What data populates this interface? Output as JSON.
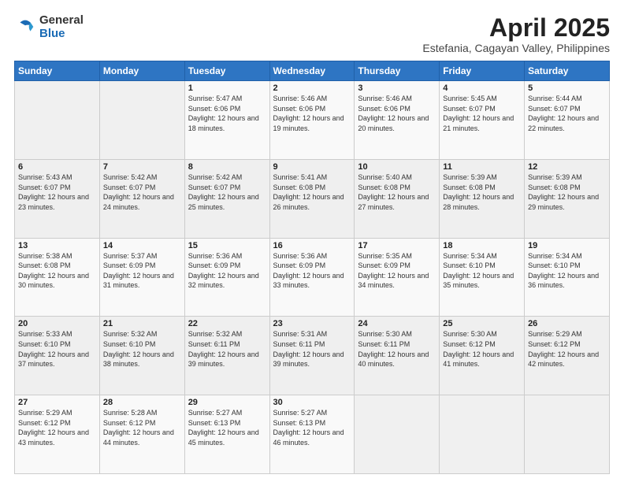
{
  "logo": {
    "general": "General",
    "blue": "Blue"
  },
  "title": {
    "month_year": "April 2025",
    "location": "Estefania, Cagayan Valley, Philippines"
  },
  "weekdays": [
    "Sunday",
    "Monday",
    "Tuesday",
    "Wednesday",
    "Thursday",
    "Friday",
    "Saturday"
  ],
  "weeks": [
    [
      {
        "day": "",
        "sunrise": "",
        "sunset": "",
        "daylight": ""
      },
      {
        "day": "",
        "sunrise": "",
        "sunset": "",
        "daylight": ""
      },
      {
        "day": "1",
        "sunrise": "Sunrise: 5:47 AM",
        "sunset": "Sunset: 6:06 PM",
        "daylight": "Daylight: 12 hours and 18 minutes."
      },
      {
        "day": "2",
        "sunrise": "Sunrise: 5:46 AM",
        "sunset": "Sunset: 6:06 PM",
        "daylight": "Daylight: 12 hours and 19 minutes."
      },
      {
        "day": "3",
        "sunrise": "Sunrise: 5:46 AM",
        "sunset": "Sunset: 6:06 PM",
        "daylight": "Daylight: 12 hours and 20 minutes."
      },
      {
        "day": "4",
        "sunrise": "Sunrise: 5:45 AM",
        "sunset": "Sunset: 6:07 PM",
        "daylight": "Daylight: 12 hours and 21 minutes."
      },
      {
        "day": "5",
        "sunrise": "Sunrise: 5:44 AM",
        "sunset": "Sunset: 6:07 PM",
        "daylight": "Daylight: 12 hours and 22 minutes."
      }
    ],
    [
      {
        "day": "6",
        "sunrise": "Sunrise: 5:43 AM",
        "sunset": "Sunset: 6:07 PM",
        "daylight": "Daylight: 12 hours and 23 minutes."
      },
      {
        "day": "7",
        "sunrise": "Sunrise: 5:42 AM",
        "sunset": "Sunset: 6:07 PM",
        "daylight": "Daylight: 12 hours and 24 minutes."
      },
      {
        "day": "8",
        "sunrise": "Sunrise: 5:42 AM",
        "sunset": "Sunset: 6:07 PM",
        "daylight": "Daylight: 12 hours and 25 minutes."
      },
      {
        "day": "9",
        "sunrise": "Sunrise: 5:41 AM",
        "sunset": "Sunset: 6:08 PM",
        "daylight": "Daylight: 12 hours and 26 minutes."
      },
      {
        "day": "10",
        "sunrise": "Sunrise: 5:40 AM",
        "sunset": "Sunset: 6:08 PM",
        "daylight": "Daylight: 12 hours and 27 minutes."
      },
      {
        "day": "11",
        "sunrise": "Sunrise: 5:39 AM",
        "sunset": "Sunset: 6:08 PM",
        "daylight": "Daylight: 12 hours and 28 minutes."
      },
      {
        "day": "12",
        "sunrise": "Sunrise: 5:39 AM",
        "sunset": "Sunset: 6:08 PM",
        "daylight": "Daylight: 12 hours and 29 minutes."
      }
    ],
    [
      {
        "day": "13",
        "sunrise": "Sunrise: 5:38 AM",
        "sunset": "Sunset: 6:08 PM",
        "daylight": "Daylight: 12 hours and 30 minutes."
      },
      {
        "day": "14",
        "sunrise": "Sunrise: 5:37 AM",
        "sunset": "Sunset: 6:09 PM",
        "daylight": "Daylight: 12 hours and 31 minutes."
      },
      {
        "day": "15",
        "sunrise": "Sunrise: 5:36 AM",
        "sunset": "Sunset: 6:09 PM",
        "daylight": "Daylight: 12 hours and 32 minutes."
      },
      {
        "day": "16",
        "sunrise": "Sunrise: 5:36 AM",
        "sunset": "Sunset: 6:09 PM",
        "daylight": "Daylight: 12 hours and 33 minutes."
      },
      {
        "day": "17",
        "sunrise": "Sunrise: 5:35 AM",
        "sunset": "Sunset: 6:09 PM",
        "daylight": "Daylight: 12 hours and 34 minutes."
      },
      {
        "day": "18",
        "sunrise": "Sunrise: 5:34 AM",
        "sunset": "Sunset: 6:10 PM",
        "daylight": "Daylight: 12 hours and 35 minutes."
      },
      {
        "day": "19",
        "sunrise": "Sunrise: 5:34 AM",
        "sunset": "Sunset: 6:10 PM",
        "daylight": "Daylight: 12 hours and 36 minutes."
      }
    ],
    [
      {
        "day": "20",
        "sunrise": "Sunrise: 5:33 AM",
        "sunset": "Sunset: 6:10 PM",
        "daylight": "Daylight: 12 hours and 37 minutes."
      },
      {
        "day": "21",
        "sunrise": "Sunrise: 5:32 AM",
        "sunset": "Sunset: 6:10 PM",
        "daylight": "Daylight: 12 hours and 38 minutes."
      },
      {
        "day": "22",
        "sunrise": "Sunrise: 5:32 AM",
        "sunset": "Sunset: 6:11 PM",
        "daylight": "Daylight: 12 hours and 39 minutes."
      },
      {
        "day": "23",
        "sunrise": "Sunrise: 5:31 AM",
        "sunset": "Sunset: 6:11 PM",
        "daylight": "Daylight: 12 hours and 39 minutes."
      },
      {
        "day": "24",
        "sunrise": "Sunrise: 5:30 AM",
        "sunset": "Sunset: 6:11 PM",
        "daylight": "Daylight: 12 hours and 40 minutes."
      },
      {
        "day": "25",
        "sunrise": "Sunrise: 5:30 AM",
        "sunset": "Sunset: 6:12 PM",
        "daylight": "Daylight: 12 hours and 41 minutes."
      },
      {
        "day": "26",
        "sunrise": "Sunrise: 5:29 AM",
        "sunset": "Sunset: 6:12 PM",
        "daylight": "Daylight: 12 hours and 42 minutes."
      }
    ],
    [
      {
        "day": "27",
        "sunrise": "Sunrise: 5:29 AM",
        "sunset": "Sunset: 6:12 PM",
        "daylight": "Daylight: 12 hours and 43 minutes."
      },
      {
        "day": "28",
        "sunrise": "Sunrise: 5:28 AM",
        "sunset": "Sunset: 6:12 PM",
        "daylight": "Daylight: 12 hours and 44 minutes."
      },
      {
        "day": "29",
        "sunrise": "Sunrise: 5:27 AM",
        "sunset": "Sunset: 6:13 PM",
        "daylight": "Daylight: 12 hours and 45 minutes."
      },
      {
        "day": "30",
        "sunrise": "Sunrise: 5:27 AM",
        "sunset": "Sunset: 6:13 PM",
        "daylight": "Daylight: 12 hours and 46 minutes."
      },
      {
        "day": "",
        "sunrise": "",
        "sunset": "",
        "daylight": ""
      },
      {
        "day": "",
        "sunrise": "",
        "sunset": "",
        "daylight": ""
      },
      {
        "day": "",
        "sunrise": "",
        "sunset": "",
        "daylight": ""
      }
    ]
  ]
}
